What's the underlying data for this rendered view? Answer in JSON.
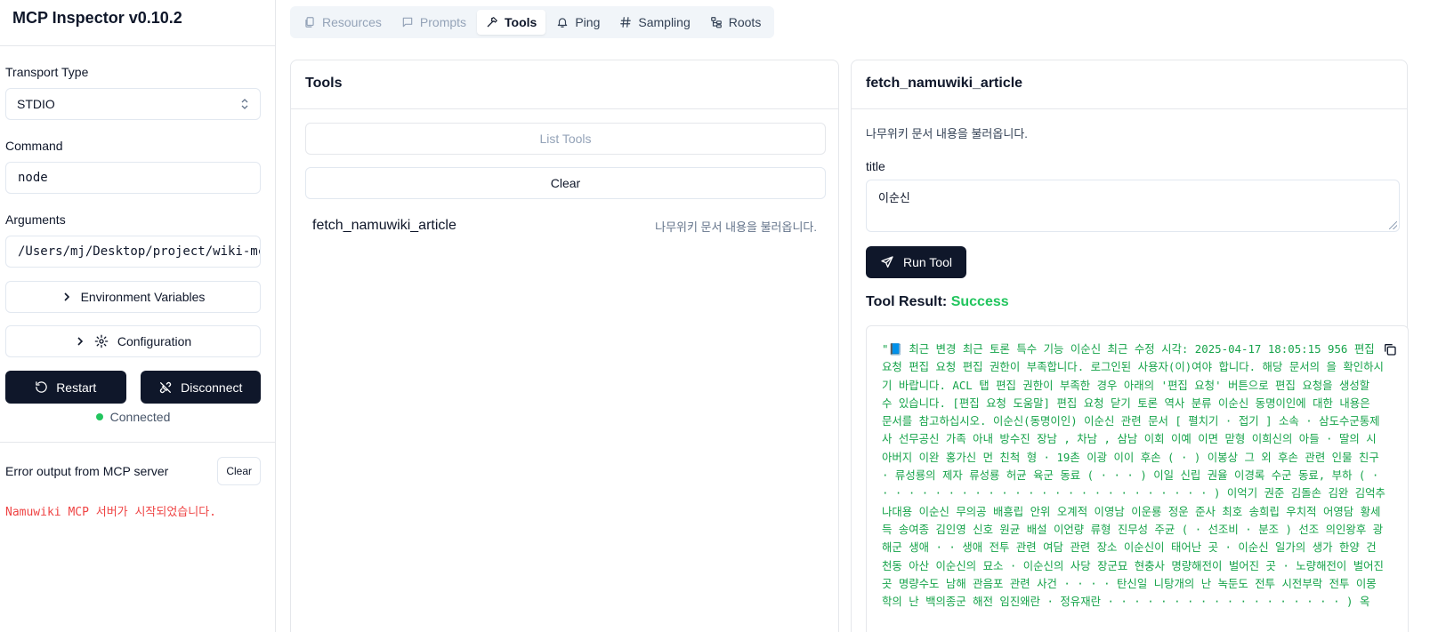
{
  "app": {
    "title": "MCP Inspector v0.10.2"
  },
  "sidebar": {
    "transport_label": "Transport Type",
    "transport_value": "STDIO",
    "command_label": "Command",
    "command_value": "node",
    "arguments_label": "Arguments",
    "arguments_value": "/Users/mj/Desktop/project/wiki-mcp/build/index.js",
    "env_button": "Environment Variables",
    "config_button": "Configuration",
    "restart_button": "Restart",
    "disconnect_button": "Disconnect",
    "status_text": "Connected",
    "error_title": "Error output from MCP server",
    "error_clear": "Clear",
    "error_text": "Namuwiki MCP 서버가 시작되었습니다."
  },
  "tabs": [
    {
      "label": "Resources",
      "icon": "files-icon",
      "state": "disabled"
    },
    {
      "label": "Prompts",
      "icon": "message-square-icon",
      "state": "disabled"
    },
    {
      "label": "Tools",
      "icon": "hammer-icon",
      "state": "active"
    },
    {
      "label": "Ping",
      "icon": "bell-icon",
      "state": "normal"
    },
    {
      "label": "Sampling",
      "icon": "hash-icon",
      "state": "normal"
    },
    {
      "label": "Roots",
      "icon": "folder-tree-icon",
      "state": "normal"
    }
  ],
  "tools_panel": {
    "title": "Tools",
    "list_button": "List Tools",
    "clear_button": "Clear",
    "items": [
      {
        "name": "fetch_namuwiki_article",
        "description": "나무위키 문서 내용을 불러옵니다."
      }
    ]
  },
  "detail_panel": {
    "title": "fetch_namuwiki_article",
    "description": "나무위키 문서 내용을 불러옵니다.",
    "param_label": "title",
    "param_value": "이순신",
    "run_button": "Run Tool",
    "result_label": "Tool Result:",
    "result_status": "Success",
    "result_text": "\"📘 최근 변경 최근 토론 특수 기능      이순신 최근 수정 시각: 2025-04-17 18:05:15 956 편집 요청 편집 요청 편집 권한이 부족합니다. 로그인된 사용자(이)여야 합니다. 해당 문서의 을 확인하시기 바랍니다. ACL 탭 편집 권한이 부족한 경우 아래의 '편집 요청' 버튼으로 편집 요청을 생성할 수 있습니다. [편집 요청 도움말] 편집 요청 닫기 토론 역사 분류 이순신            동명이인에 대한 내용은 문서를 참고하십시오. 이순신(동명이인)          이순신 관련 문서 [ 펼치기 · 접기 ] 소속 · 삼도수군통제사 선무공신 가족 아내 방수진 장남 , 차남 , 삼남 이회 이예 이면 맏형 이희신의 아들 · 딸의 시아버지 이완 홍가신 먼 친척 형 · 19촌 이광 이이 후손 ( · ) 이봉상 그 외 후손 관련 인물 친구 · 류성룡의 제자 류성룡 허균 육군 동료 ( · · · ) 이일 신립 권율 이경록 수군 동료, 부하 ( · · · · · · · · · · · · · · · · · · · · · · · · · · ) 이억기 권준 김돌손 김완 김억추 나대용 이순신 무의공 배흥립 안위 오계적 이영남 이운룡 정운 준사 최호 송희립 우치적 어영담 황세득 송여종 김인영 신호 원균 배설 이언량 류형 진무성 주균 ( · 선조비 · 분조 ) 선조 의인왕후 광해군 생애 · · 생애 전투 관련 여담 관련 장소 이순신이 태어난 곳 · 이순신 일가의 생가 한양 건천동 아산 이순신의 묘소 · 이순신의 사당 장군묘 현충사 명량해전이 벌어진 곳 · 노량해전이 벌어진 곳  명량수도 남해 관음포 관련 사건 · ·  · ·  탄신일 니탕개의 난 녹둔도 전투 시전부락 전투 이몽학의 난 백의종군 해전 임진왜란 · 정유재란 · · · · · · · · · · · · · · · · · · ) 옥"
  },
  "colors": {
    "primary_dark": "#0f172a",
    "success": "#22c55e",
    "result_text": "#16a34a",
    "error_text": "#ef4444"
  }
}
